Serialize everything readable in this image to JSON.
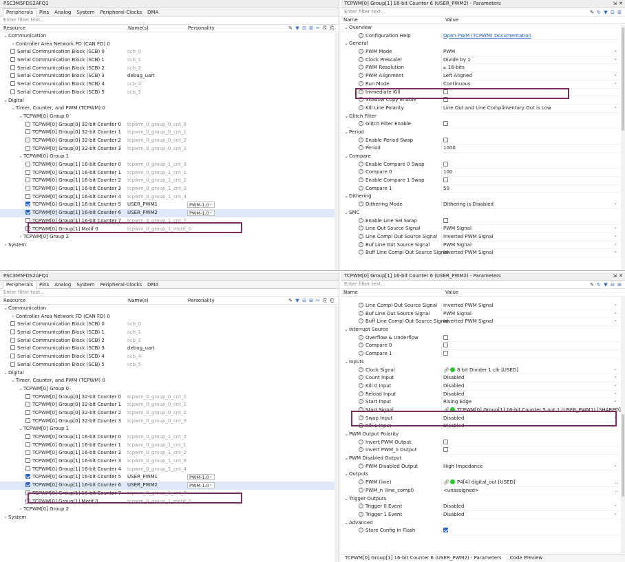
{
  "left_title": "PSC3M5FDS2AFQ1",
  "left_tabs": [
    "Peripherals",
    "Pins",
    "Analog",
    "System",
    "Peripheral-Clocks",
    "DMA"
  ],
  "filter_placeholder": "Enter filter text...",
  "res_headers": {
    "resource": "Resource",
    "names": "Name(s)",
    "personality": "Personality"
  },
  "right_title": "TCPWM[0] Group[1] 16-bit Counter 6 (USER_PWM2) - Parameters",
  "param_headers": {
    "name": "Name",
    "value": "Value"
  },
  "icons": {
    "filter": "filter-icon",
    "collapse": "collapse-all-icon",
    "expand": "expand-all-icon",
    "help": "help-icon",
    "reset": "reset-icon",
    "link": "link-icon",
    "close": "close-icon",
    "pin": "pin-icon"
  },
  "colors": {
    "highlight": "#7a2d5e",
    "status_green": "#27c82a",
    "link": "#1e5bc6",
    "selected": "#dde9f7"
  },
  "tree": [
    {
      "lvl": 0,
      "exp": true,
      "label": "Communication"
    },
    {
      "lvl": 1,
      "exp": false,
      "label": "Controller Area Network FD (CAN FD) 0"
    },
    {
      "lvl": 1,
      "cb": false,
      "label": "Serial Communication Block (SCB) 0",
      "name": "scb_0"
    },
    {
      "lvl": 1,
      "cb": false,
      "label": "Serial Communication Block (SCB) 1",
      "name": "scb_1"
    },
    {
      "lvl": 1,
      "cb": false,
      "label": "Serial Communication Block (SCB) 2",
      "name": "scb_2"
    },
    {
      "lvl": 1,
      "cb": false,
      "label": "Serial Communication Block (SCB) 3",
      "name": "debug_uart",
      "dark": true
    },
    {
      "lvl": 1,
      "cb": false,
      "label": "Serial Communication Block (SCB) 4",
      "name": "scb_4"
    },
    {
      "lvl": 1,
      "cb": false,
      "label": "Serial Communication Block (SCB) 5",
      "name": "scb_5"
    },
    {
      "lvl": 0,
      "exp": true,
      "label": "Digital"
    },
    {
      "lvl": 1,
      "exp": true,
      "label": "Timer, Counter, and PWM (TCPWM) 0"
    },
    {
      "lvl": 2,
      "exp": true,
      "label": "TCPWM[0] Group 0"
    },
    {
      "lvl": 3,
      "cb": false,
      "label": "TCPWM[0] Group[0] 32-bit Counter 0",
      "name": "tcpwm_0_group_0_cnt_0"
    },
    {
      "lvl": 3,
      "cb": false,
      "label": "TCPWM[0] Group[0] 32-bit Counter 1",
      "name": "tcpwm_0_group_0_cnt_1"
    },
    {
      "lvl": 3,
      "cb": false,
      "label": "TCPWM[0] Group[0] 32-bit Counter 2",
      "name": "tcpwm_0_group_0_cnt_2"
    },
    {
      "lvl": 3,
      "cb": false,
      "label": "TCPWM[0] Group[0] 32-bit Counter 3",
      "name": "tcpwm_0_group_0_cnt_3"
    },
    {
      "lvl": 2,
      "exp": true,
      "label": "TCPWM[0] Group 1"
    },
    {
      "lvl": 3,
      "cb": false,
      "label": "TCPWM[0] Group[1] 16-bit Counter 0",
      "name": "tcpwm_0_group_1_cnt_0"
    },
    {
      "lvl": 3,
      "cb": false,
      "label": "TCPWM[0] Group[1] 16-bit Counter 1",
      "name": "tcpwm_0_group_1_cnt_1"
    },
    {
      "lvl": 3,
      "cb": false,
      "label": "TCPWM[0] Group[1] 16-bit Counter 2",
      "name": "tcpwm_0_group_1_cnt_2"
    },
    {
      "lvl": 3,
      "cb": false,
      "label": "TCPWM[0] Group[1] 16-bit Counter 3",
      "name": "tcpwm_0_group_1_cnt_3"
    },
    {
      "lvl": 3,
      "cb": false,
      "label": "TCPWM[0] Group[1] 16-bit Counter 4",
      "name": "tcpwm_0_group_1_cnt_4"
    },
    {
      "lvl": 3,
      "cb": true,
      "label": "TCPWM[0] Group[1] 16-bit Counter 5",
      "name": "USER_PWM1",
      "dark": true,
      "pers": "PWM-1.0"
    },
    {
      "lvl": 3,
      "cb": true,
      "label": "TCPWM[0] Group[1] 16-bit Counter 6",
      "name": "USER_PWM2",
      "dark": true,
      "pers": "PWM-1.0",
      "selected": true
    },
    {
      "lvl": 3,
      "cb": false,
      "label": "TCPWM[0] Group[1] 16-bit Counter 7",
      "name": "tcpwm_0_group_1_cnt_7"
    },
    {
      "lvl": 3,
      "cb": false,
      "label": "TCPWM[0] Group[1] Motif 0",
      "name": "tcpwm_0_group_1_motif_0"
    },
    {
      "lvl": 2,
      "exp": false,
      "label": "TCPWM[0] Group 2"
    },
    {
      "lvl": 0,
      "exp": false,
      "label": "System"
    }
  ],
  "params_top": [
    {
      "cat": "Overview"
    },
    {
      "name": "Configuration Help",
      "link": "Open PWM (TCPWM) Documentation"
    },
    {
      "cat": "General"
    },
    {
      "name": "PWM Mode",
      "val": "PWM",
      "dd": true
    },
    {
      "name": "Clock Prescaler",
      "val": "Divide by 1",
      "dd": true
    },
    {
      "name": "PWM Resolution",
      "val": "16-bits",
      "lock": true
    },
    {
      "name": "PWM Alignment",
      "val": "Left Aligned",
      "dd": true
    },
    {
      "name": "Run Mode",
      "val": "Continuous",
      "dd": true
    },
    {
      "name": "Immediate Kill",
      "cbv": false
    },
    {
      "name": "Shadow Copy Enable",
      "cbv": false
    },
    {
      "name": "Kill Line Polarity",
      "val": "Line Out and Line Complimentary Out is Low",
      "dd": true
    },
    {
      "cat": "Glitch Filter"
    },
    {
      "name": "Glitch Filter Enable",
      "cbv": false
    },
    {
      "cat": "Period"
    },
    {
      "name": "Enable Period Swap",
      "cbv": false
    },
    {
      "name": "Period",
      "val": "1000"
    },
    {
      "cat": "Compare"
    },
    {
      "name": "Enable Compare 0 Swap",
      "cbv": false
    },
    {
      "name": "Compare 0",
      "val": "100"
    },
    {
      "name": "Enable Compare 1 Swap",
      "cbv": false
    },
    {
      "name": "Compare 1",
      "val": "50"
    },
    {
      "cat": "Dithering"
    },
    {
      "name": "Dithering Mode",
      "val": "Dithering is Disabled",
      "dd": true
    },
    {
      "cat": "SMC"
    },
    {
      "name": "Enable Line Sel Swap",
      "cbv": false
    },
    {
      "name": "Line Out Source Signal",
      "val": "PWM Signal",
      "dd": true
    },
    {
      "name": "Line Compl Out Source Signal",
      "val": "Inverted PWM Signal",
      "dd": true
    },
    {
      "name": "Buf Line Out Source Signal",
      "val": "PWM Signal",
      "dd": true
    },
    {
      "name": "Buff Line Compl Out Source Signal",
      "val": "Inverted PWM Signal",
      "dd": true
    }
  ],
  "params_bottom": [
    {
      "name": "Line Compl Out Source Signal",
      "val": "Inverted PWM Signal",
      "dd": true
    },
    {
      "name": "Buf Line Out Source Signal",
      "val": "PWM Signal",
      "dd": true
    },
    {
      "name": "Buff Line Compl Out Source Signal",
      "val": "Inverted PWM Signal",
      "dd": true
    },
    {
      "cat": "Interrupt Source"
    },
    {
      "name": "Overflow & Underflow",
      "cbv": false
    },
    {
      "name": "Compare 0",
      "cbv": false
    },
    {
      "name": "Compare 1",
      "cbv": false
    },
    {
      "cat": "Inputs"
    },
    {
      "name": "Clock Signal",
      "val": "8 bit Divider 1 clk [USED]",
      "lnk": true,
      "dot": true,
      "dd": true
    },
    {
      "name": "Count Input",
      "val": "Disabled",
      "dd": true
    },
    {
      "name": "Kill 0 Input",
      "val": "Disabled",
      "dd": true
    },
    {
      "name": "Reload Input",
      "val": "Disabled",
      "dd": true
    },
    {
      "name": "Start Input",
      "val": "Rising Edge",
      "dd": true
    },
    {
      "name": "Start Signal",
      "val": "TCPWM[0] Group[1] 16-bit Counter 5 out 1 (USER_PWM1) [SHARED]",
      "lnk": true,
      "dot": true,
      "dd": true
    },
    {
      "name": "Swap Input",
      "val": "Disabled",
      "dd": true
    },
    {
      "name": "Kill 1 Input",
      "val": "Disabled",
      "dd": true
    },
    {
      "cat": "PWM Output Polarity"
    },
    {
      "name": "Invert PWM Output",
      "cbv": false
    },
    {
      "name": "Invert PWM_n Output",
      "cbv": false
    },
    {
      "cat": "PWM Disabled Output"
    },
    {
      "name": "PWM Disabled Output",
      "val": "High Impedance",
      "dd": true
    },
    {
      "cat": "Outputs"
    },
    {
      "name": "PWM (line)",
      "val": "P4[4] digital_out [USED]",
      "lnk": true,
      "dot": true,
      "more": true
    },
    {
      "name": "PWM_n (line_compl)",
      "val": "<unassigned>",
      "more": true
    },
    {
      "cat": "Trigger Outputs"
    },
    {
      "name": "Trigger 0 Event",
      "val": "Disabled",
      "dd": true
    },
    {
      "name": "Trigger 1 Event",
      "val": "Disabled",
      "dd": true
    },
    {
      "cat": "Advanced"
    },
    {
      "name": "Store Config in Flash",
      "cbv": true
    }
  ],
  "bottom_tabs": [
    "TCPWM[0] Group[1] 16-bit Counter 6 (USER_PWM2) - Parameters",
    "Code Preview"
  ]
}
